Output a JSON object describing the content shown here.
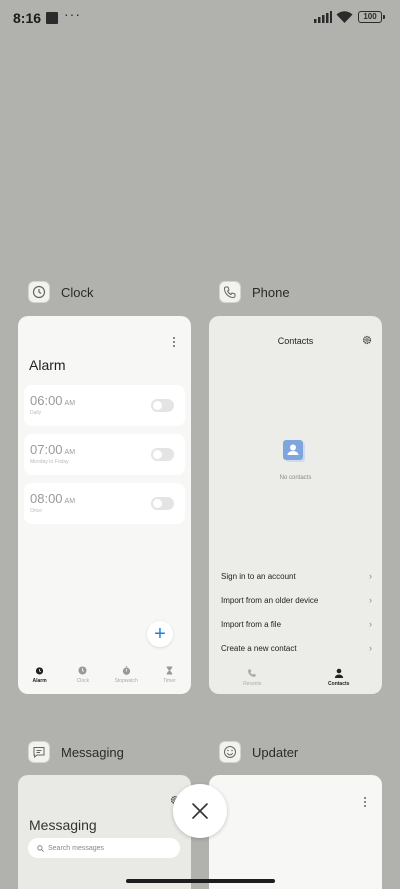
{
  "status_bar": {
    "time": "8:16",
    "dots": "···",
    "battery": "100"
  },
  "apps": {
    "clock": {
      "name": "Clock",
      "title": "Alarm",
      "alarms": [
        {
          "time": "06:00",
          "ampm": "AM",
          "sub": "Daily"
        },
        {
          "time": "07:00",
          "ampm": "AM",
          "sub": "Monday to Friday"
        },
        {
          "time": "08:00",
          "ampm": "AM",
          "sub": "Once"
        }
      ],
      "fab": "+",
      "nav": [
        {
          "label": "Alarm"
        },
        {
          "label": "Clock"
        },
        {
          "label": "Stopwatch"
        },
        {
          "label": "Timer"
        }
      ]
    },
    "phone": {
      "name": "Phone",
      "title": "Contacts",
      "empty_text": "No contacts",
      "menu": [
        {
          "label": "Sign in to an account"
        },
        {
          "label": "Import from an older device"
        },
        {
          "label": "Import from a file"
        },
        {
          "label": "Create a new contact"
        }
      ],
      "nav": [
        {
          "label": "Recents"
        },
        {
          "label": "Contacts"
        }
      ]
    },
    "messaging": {
      "name": "Messaging",
      "title": "Messaging",
      "search_placeholder": "Search messages"
    },
    "updater": {
      "name": "Updater"
    }
  },
  "colors": {
    "background": "#b1b1ad",
    "accent": "#1f7fe0",
    "contact_avatar": "#7ea6dd"
  }
}
